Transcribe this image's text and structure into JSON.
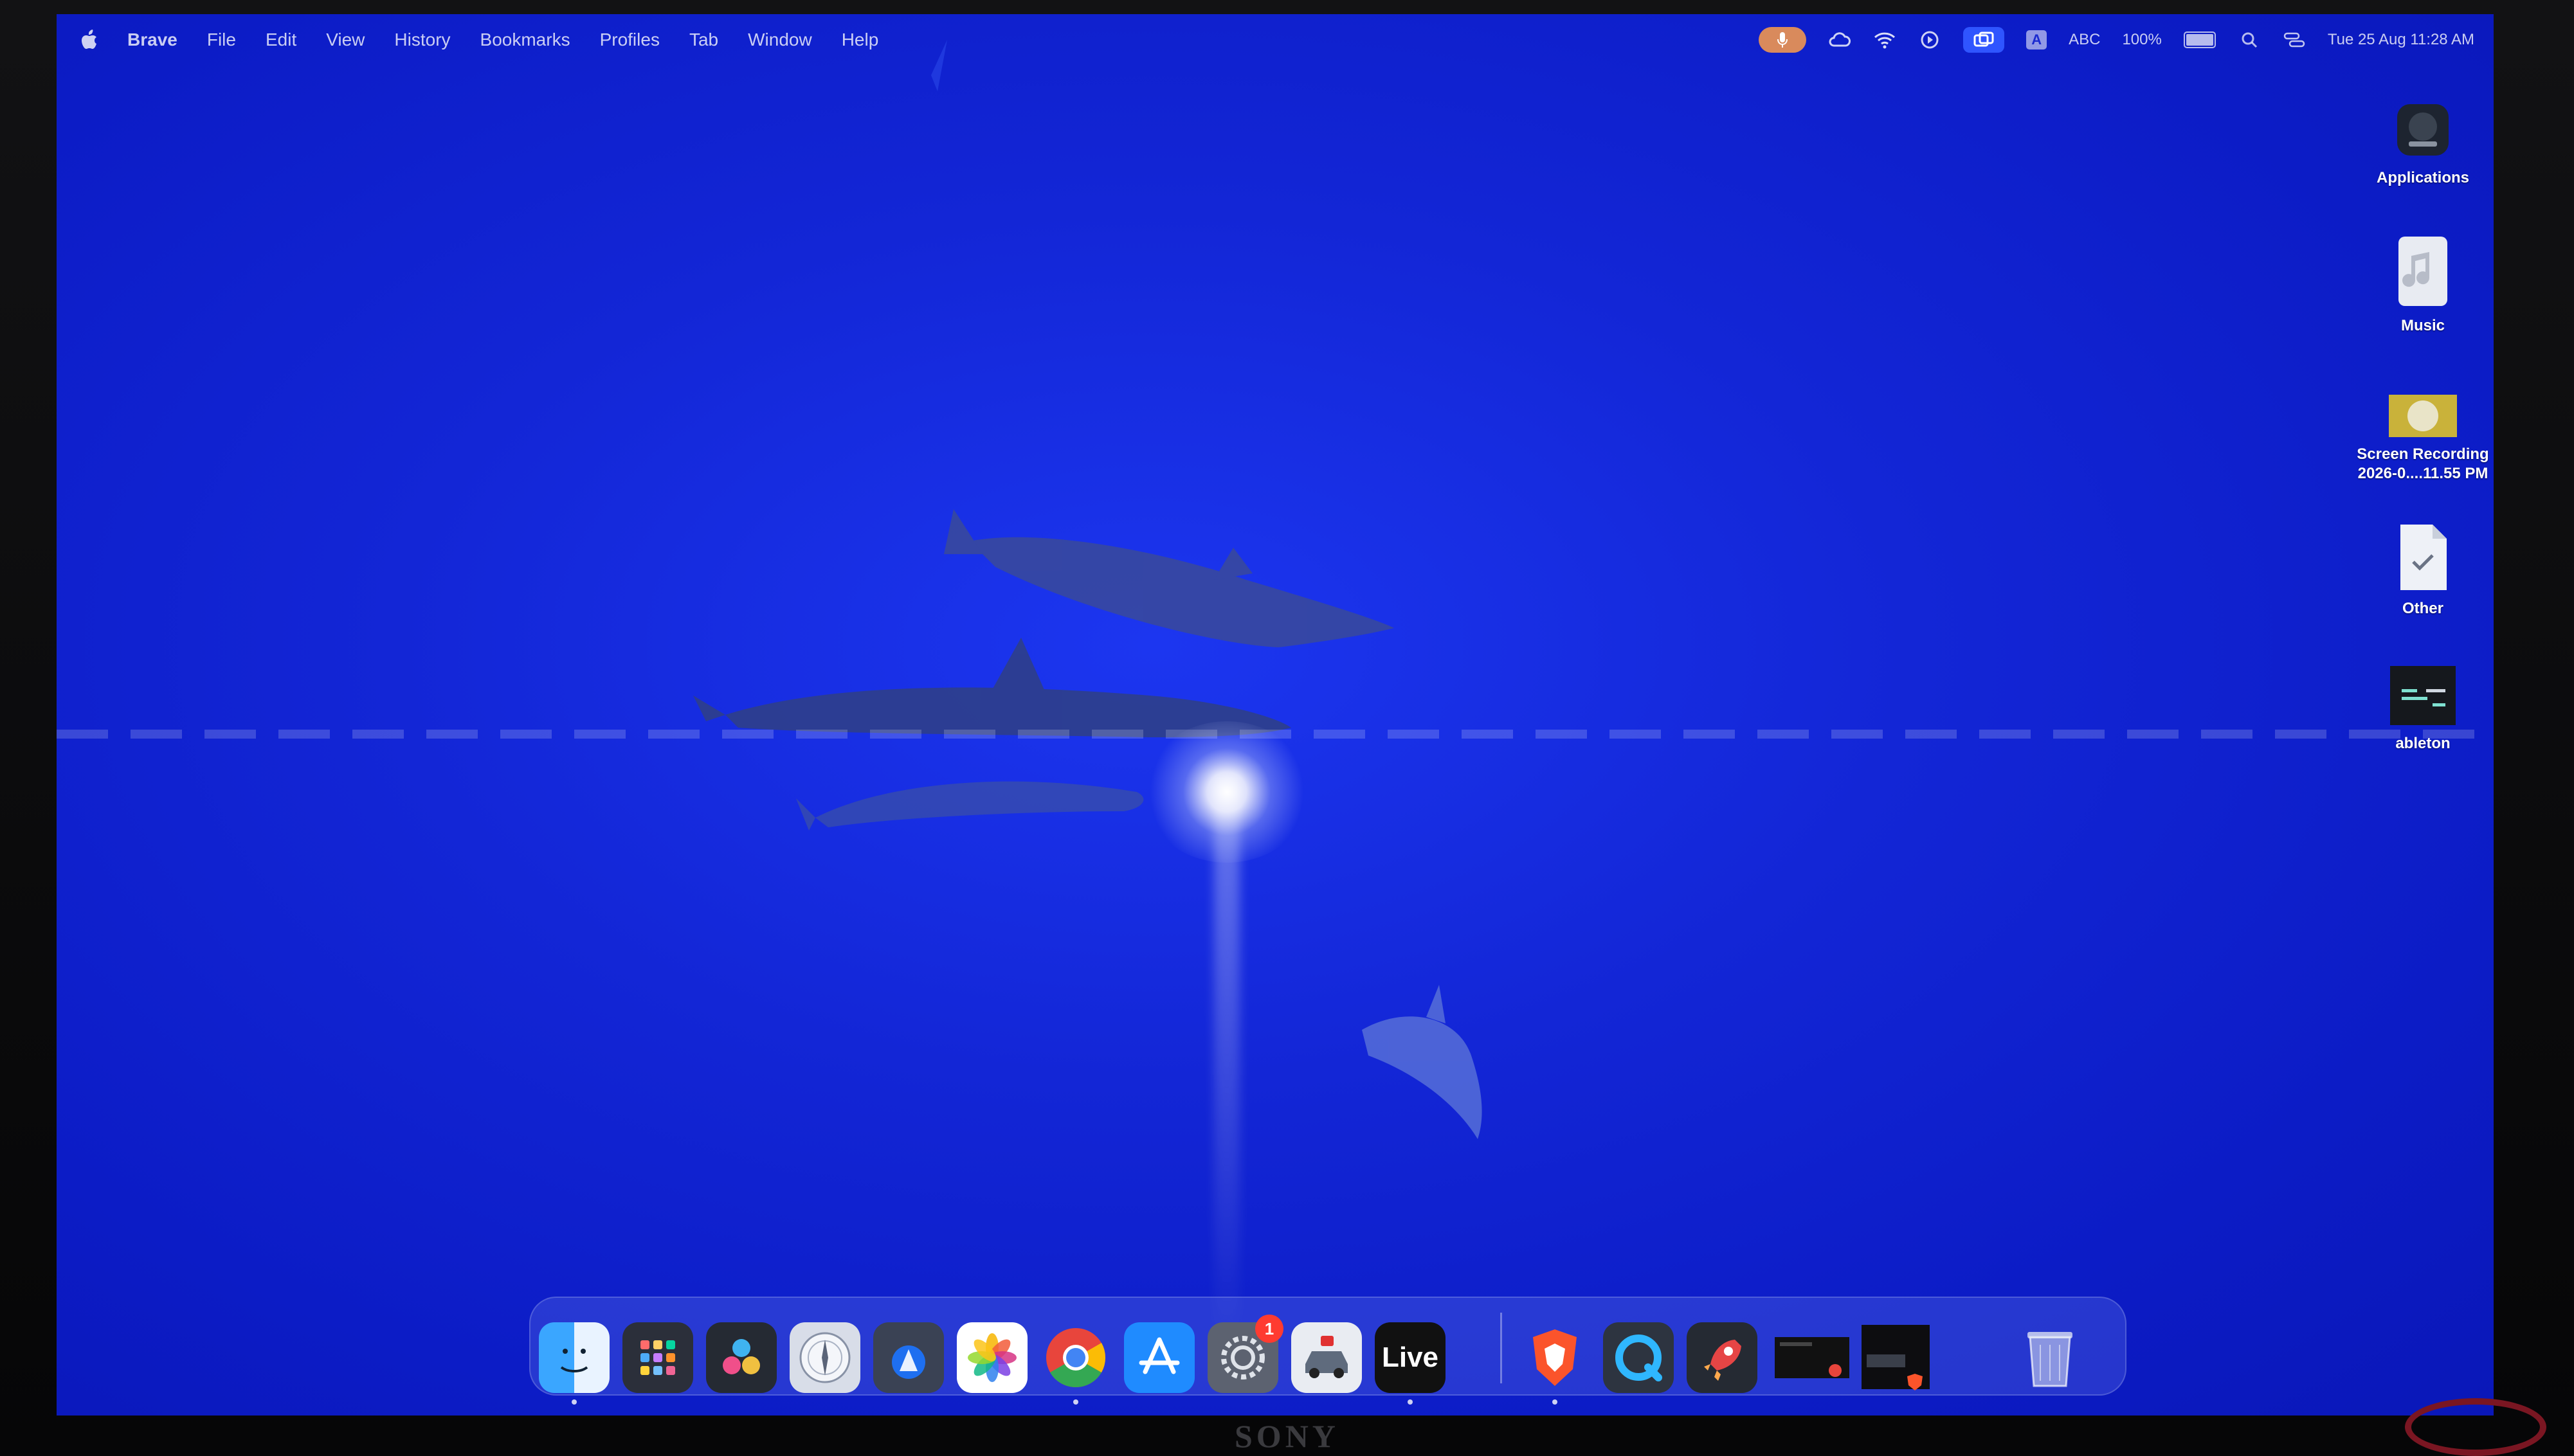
{
  "menubar": {
    "app_name": "Brave",
    "items": [
      "File",
      "Edit",
      "View",
      "History",
      "Bookmarks",
      "Profiles",
      "Tab",
      "Window",
      "Help"
    ],
    "status": {
      "input_source_badge": "A",
      "input_source_name": "ABC",
      "battery_percent": "100%",
      "datetime": "Tue 25 Aug  11:28 AM"
    }
  },
  "desktop_icons": [
    {
      "label": "Applications",
      "icon": "analog-lab-icon"
    },
    {
      "label": "Music",
      "icon": "music-file-icon"
    },
    {
      "label": "Screen Recording 2026-0....11.55 PM",
      "icon": "screen-recording-thumbnail"
    },
    {
      "label": "Other",
      "icon": "document-icon"
    },
    {
      "label": "ableton",
      "icon": "ableton-folder-icon"
    }
  ],
  "dock": {
    "apps": [
      {
        "name": "finder",
        "icon": "finder-icon",
        "running": true
      },
      {
        "name": "launchpad",
        "icon": "launchpad-icon",
        "running": false
      },
      {
        "name": "davinci-resolve",
        "icon": "davinci-resolve-icon",
        "running": false
      },
      {
        "name": "safari-like-compass",
        "icon": "compass-icon",
        "running": false
      },
      {
        "name": "xcode-instruments",
        "icon": "instruments-icon",
        "running": false
      },
      {
        "name": "photos",
        "icon": "photos-icon",
        "running": false
      },
      {
        "name": "chrome",
        "icon": "chrome-icon",
        "running": true
      },
      {
        "name": "app-store",
        "icon": "app-store-icon",
        "running": false
      },
      {
        "name": "system-settings",
        "icon": "settings-icon",
        "running": false,
        "badge": "1"
      },
      {
        "name": "car-app",
        "icon": "car-icon",
        "running": false
      },
      {
        "name": "ableton-live",
        "icon": "live-icon",
        "running": true,
        "label": "Live"
      },
      {
        "name": "brave",
        "icon": "brave-icon",
        "running": true
      },
      {
        "name": "quicktime",
        "icon": "quicktime-icon",
        "running": false
      },
      {
        "name": "rocket",
        "icon": "rocket-icon",
        "running": false
      },
      {
        "name": "recent-window-1",
        "icon": "window-thumbnail-icon",
        "running": false
      },
      {
        "name": "recent-window-2",
        "icon": "window-thumbnail-icon",
        "running": false
      },
      {
        "name": "trash",
        "icon": "trash-icon",
        "running": false
      }
    ]
  },
  "monitor": {
    "brand": "SONY"
  },
  "colors": {
    "desktop_blue": "#1326d6",
    "badge_red": "#ff3b30",
    "mic_orange": "#d98a5c"
  }
}
